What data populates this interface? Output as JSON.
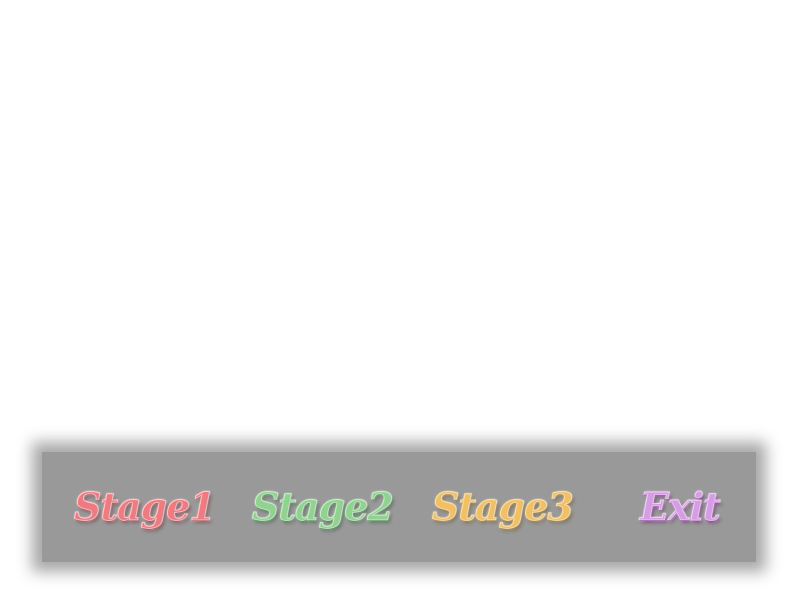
{
  "menu": {
    "items": [
      {
        "label": "Stage1",
        "color": "#f07a80"
      },
      {
        "label": "Stage2",
        "color": "#8fd38f"
      },
      {
        "label": "Stage3",
        "color": "#f2c060"
      },
      {
        "label": "Exit",
        "color": "#d79ce6"
      }
    ],
    "panel_color": "#999999",
    "background_color": "#ffffff"
  }
}
